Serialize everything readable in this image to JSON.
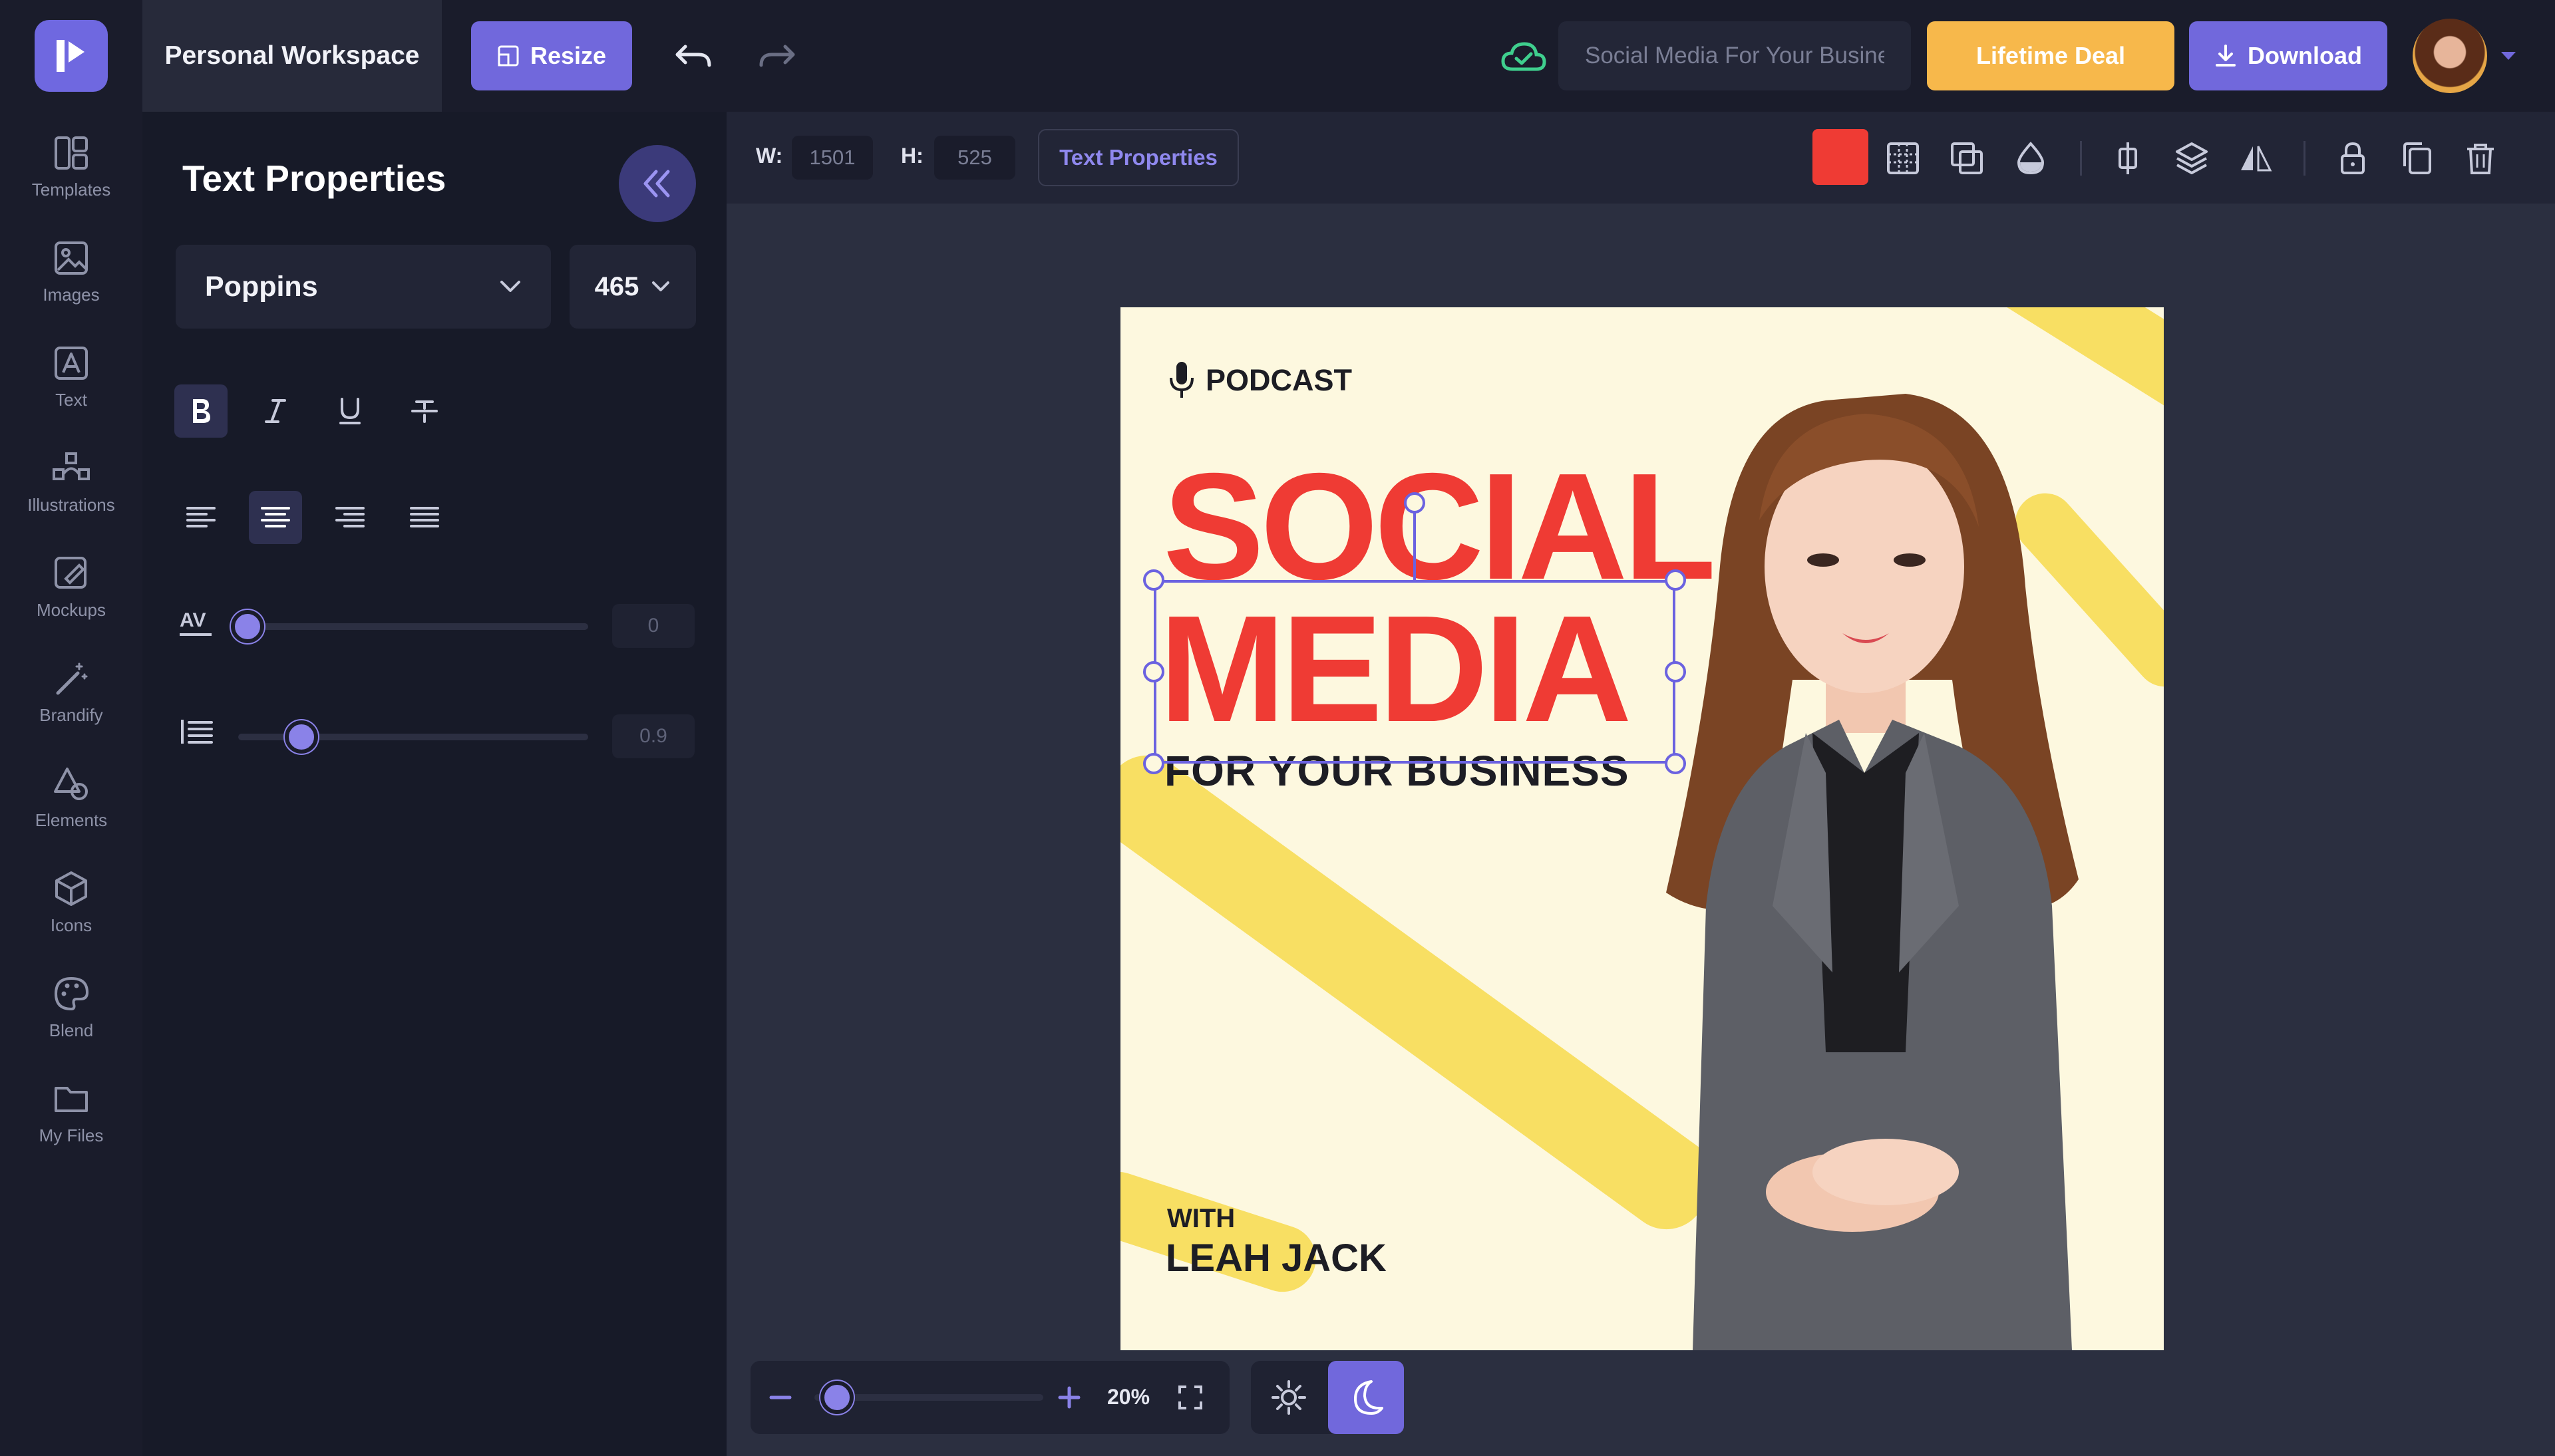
{
  "topbar": {
    "workspace": "Personal Workspace",
    "resize_label": "Resize",
    "doc_title": "Social Media For Your Business",
    "deal_label": "Lifetime Deal",
    "download_label": "Download"
  },
  "rail": {
    "items": [
      {
        "label": "Templates",
        "icon": "templates-icon"
      },
      {
        "label": "Images",
        "icon": "image-icon"
      },
      {
        "label": "Text",
        "icon": "text-icon"
      },
      {
        "label": "Illustrations",
        "icon": "illustrations-icon"
      },
      {
        "label": "Mockups",
        "icon": "mockups-icon"
      },
      {
        "label": "Brandify",
        "icon": "magic-wand-icon"
      },
      {
        "label": "Elements",
        "icon": "shapes-icon"
      },
      {
        "label": "Icons",
        "icon": "cube-icon"
      },
      {
        "label": "Blend",
        "icon": "palette-icon"
      },
      {
        "label": "My Files",
        "icon": "folder-icon"
      }
    ]
  },
  "panel": {
    "title": "Text Properties",
    "font": "Poppins",
    "font_size": "465",
    "letter_spacing": "0",
    "line_height": "0.9",
    "letter_spacing_level": 0,
    "line_height_level": 0.18
  },
  "context": {
    "w_label": "W:",
    "w_value": "1501",
    "h_label": "H:",
    "h_value": "525",
    "label": "Text Properties",
    "color": "#ef3b34"
  },
  "design": {
    "tag": "PODCAST",
    "line1": "SOCIAL",
    "line2": "MEDIA",
    "line3": "FOR YOUR BUSINESS",
    "with": "WITH",
    "host": "LEAH JACK"
  },
  "zoom": {
    "value": "20%",
    "level": 0.1
  },
  "colors": {
    "accent": "#7168dc",
    "deal": "#f7b84b",
    "headline": "#ef3b34",
    "canvas_bg": "#fdf8df",
    "stroke_yellow": "#f8df63"
  }
}
